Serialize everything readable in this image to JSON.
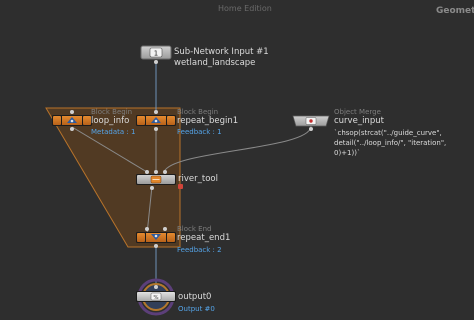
{
  "header": {
    "center_label": "Home Edition",
    "right_label": "Geometry"
  },
  "nodes": {
    "subnet_input": {
      "name": "Sub-Network Input #1",
      "subname": "wetland_landscape",
      "badge": "1",
      "icon": "subnet-input-icon"
    },
    "loop_info": {
      "type": "Block Begin",
      "name": "loop_info",
      "meta": "Metadata : 1",
      "icon": "block-begin-icon"
    },
    "repeat_begin1": {
      "type": "Block Begin",
      "name": "repeat_begin1",
      "meta": "Feedback : 1",
      "icon": "block-begin-icon"
    },
    "curve_input": {
      "type": "Object Merge",
      "name": "curve_input",
      "expression": [
        "`chsop(strcat(\"../guide_curve\",",
        "detail(\"../loop_info/\", \"iteration\",",
        "0)+1))`"
      ],
      "icon": "object-merge-icon"
    },
    "river_tool": {
      "name": "river_tool",
      "icon": "hda-icon"
    },
    "repeat_end1": {
      "type": "Block End",
      "name": "repeat_end1",
      "meta": "Feedback : 2",
      "icon": "block-end-icon"
    },
    "output0": {
      "name": "output0",
      "meta": "Output #0",
      "icon": "output-icon"
    }
  },
  "colors": {
    "background": "#2e2e2e",
    "block_region": "#5b3e20",
    "block_border": "#b8732a",
    "node_orange": "#d6771f",
    "node_grey": "#b4b4b4",
    "wire_blue": "#6f93b8",
    "wire_grey": "#8a8a8a",
    "meta_blue": "#55a4e8",
    "display_flag": "#3a5ea8"
  }
}
